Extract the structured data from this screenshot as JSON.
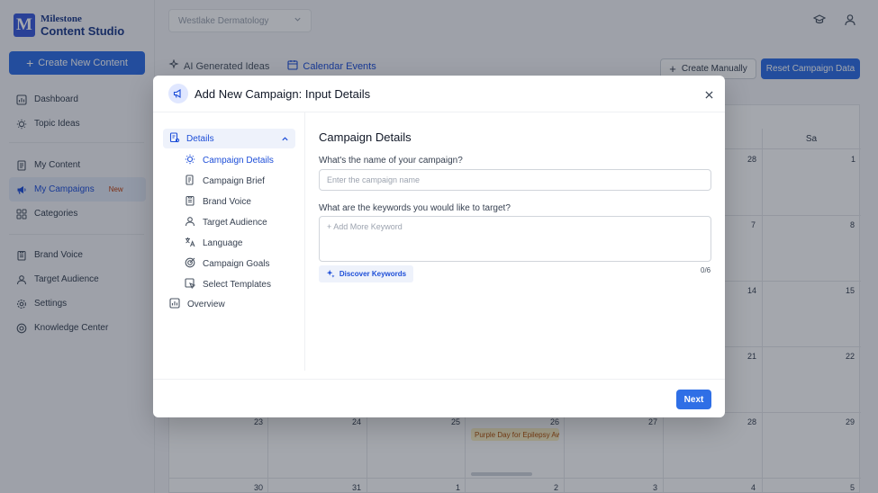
{
  "app": {
    "logo_small": "Milestone",
    "logo_big": "Content Studio",
    "logo_mark": "M"
  },
  "sidebar": {
    "create_button": "Create New Content",
    "items": [
      {
        "label": "Dashboard",
        "icon": "dashboard-icon"
      },
      {
        "label": "Topic Ideas",
        "icon": "lightbulb-icon"
      },
      {
        "label": "My Content",
        "icon": "document-icon"
      },
      {
        "label": "My Campaigns",
        "icon": "megaphone-icon",
        "active": true,
        "badge": "New"
      },
      {
        "label": "Categories",
        "icon": "grid-icon"
      },
      {
        "label": "Brand Voice",
        "icon": "clipboard-icon"
      },
      {
        "label": "Target Audience",
        "icon": "users-icon"
      },
      {
        "label": "Settings",
        "icon": "gear-icon"
      },
      {
        "label": "Knowledge Center",
        "icon": "help-icon"
      }
    ]
  },
  "topbar": {
    "clinic": "Westlake Dermatology"
  },
  "tabs": [
    {
      "label": "AI Generated Ideas",
      "icon": "sparkle-icon"
    },
    {
      "label": "Calendar Events",
      "icon": "calendar-icon",
      "active": true
    }
  ],
  "actions": {
    "create_manually": "Create Manually",
    "reset": "Reset Campaign Data"
  },
  "calendar": {
    "header_sa": "Sa",
    "days": [
      "28",
      "1",
      "7",
      "8",
      "14",
      "15",
      "21",
      "22",
      "23",
      "24",
      "25",
      "26",
      "27",
      "28",
      "29",
      "30",
      "31",
      "1",
      "2",
      "3",
      "4",
      "5"
    ],
    "event": "Purple Day for Epilepsy Awareness"
  },
  "modal": {
    "title": "Add New Campaign: Input Details",
    "steps": {
      "group": "Details",
      "sub": [
        "Campaign Details",
        "Campaign Brief",
        "Brand Voice",
        "Target Audience",
        "Language",
        "Campaign Goals",
        "Select Templates"
      ],
      "overview": "Overview"
    },
    "form": {
      "title": "Campaign Details",
      "name_label": "What's the name of your campaign?",
      "name_placeholder": "Enter the campaign name",
      "keywords_label": "What are the keywords you would like to target?",
      "keywords_placeholder": "+ Add More Keyword",
      "discover_button": "Discover Keywords",
      "keyword_count": "0/6"
    },
    "next_button": "Next"
  }
}
